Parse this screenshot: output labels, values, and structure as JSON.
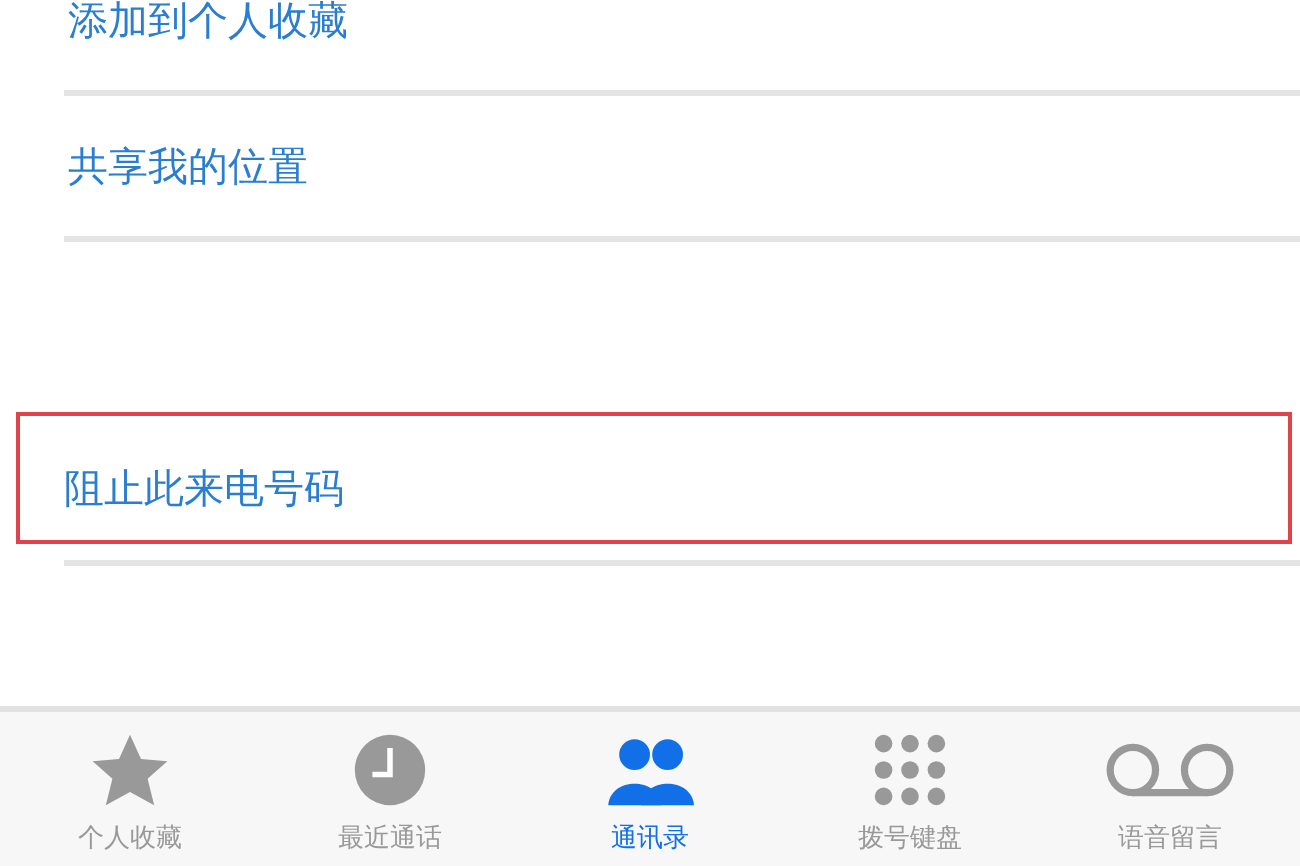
{
  "menu_groups": [
    {
      "items": [
        {
          "label": "添加到个人收藏",
          "highlighted": false
        },
        {
          "label": "共享我的位置",
          "highlighted": false
        }
      ]
    },
    {
      "items": [
        {
          "label": "阻止此来电号码",
          "highlighted": true
        }
      ]
    }
  ],
  "tab_bar": [
    {
      "label": "个人收藏",
      "kind": "star",
      "selected": false
    },
    {
      "label": "最近通话",
      "kind": "clock",
      "selected": false
    },
    {
      "label": "通讯录",
      "kind": "contacts",
      "selected": true
    },
    {
      "label": "拨号键盘",
      "kind": "keypad",
      "selected": false
    },
    {
      "label": "语音留言",
      "kind": "voicemail",
      "selected": false
    }
  ]
}
